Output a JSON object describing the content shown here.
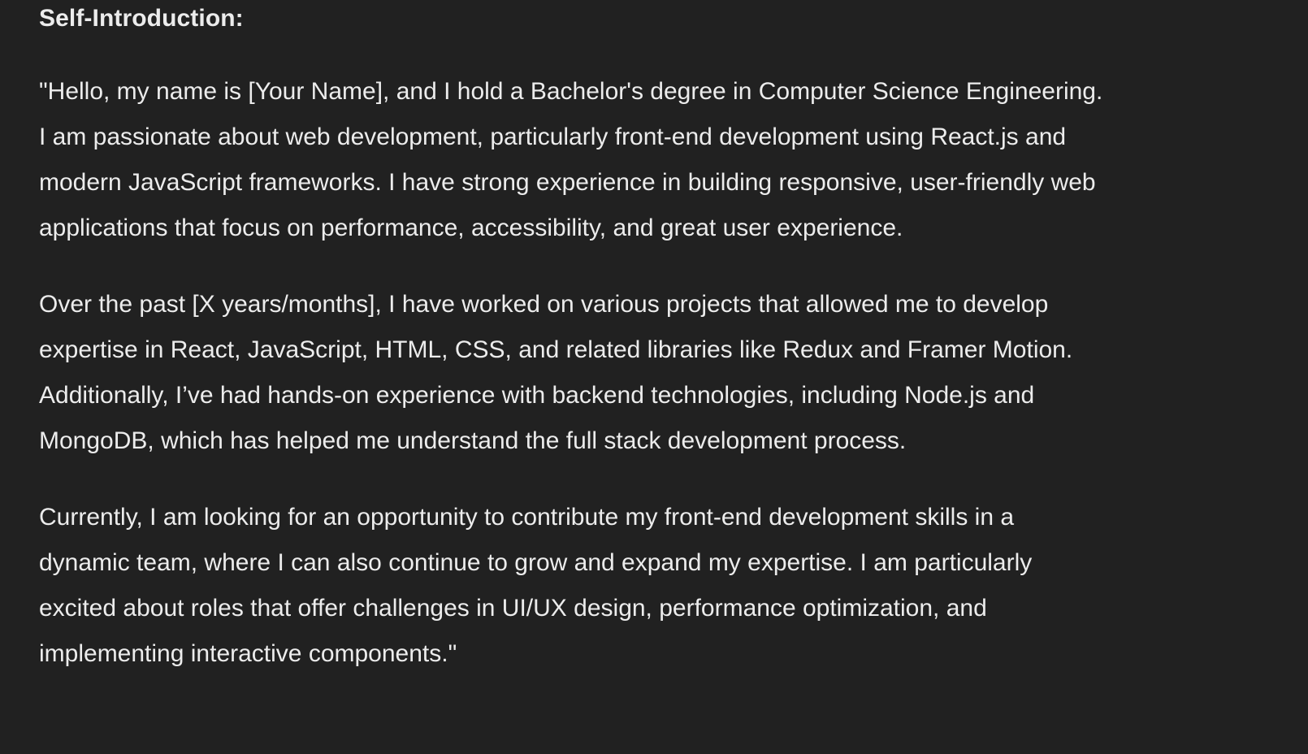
{
  "message": {
    "heading": "Self-Introduction:",
    "paragraphs": [
      {
        "lines": [
          "\"Hello, my name is [Your Name], and I hold a Bachelor's degree in Computer Science Engineering.",
          "I am passionate about web development, particularly front-end development using React.js and",
          "modern JavaScript frameworks. I have strong experience in building responsive, user-friendly web",
          "applications that focus on performance, accessibility, and great user experience."
        ]
      },
      {
        "lines": [
          "Over the past [X years/months], I have worked on various projects that allowed me to develop",
          "expertise in React, JavaScript, HTML, CSS, and related libraries like Redux and Framer Motion.",
          "Additionally, I’ve had hands-on experience with backend technologies, including Node.js and",
          "MongoDB, which has helped me understand the full stack development process."
        ]
      },
      {
        "lines": [
          "Currently, I am looking for an opportunity to contribute my front-end development skills in a",
          "dynamic team, where I can also continue to grow and expand my expertise. I am particularly",
          "excited about roles that offer challenges in UI/UX design, performance optimization, and",
          "implementing interactive components.\""
        ]
      }
    ]
  },
  "colors": {
    "background": "#212121",
    "text": "#ececec"
  }
}
